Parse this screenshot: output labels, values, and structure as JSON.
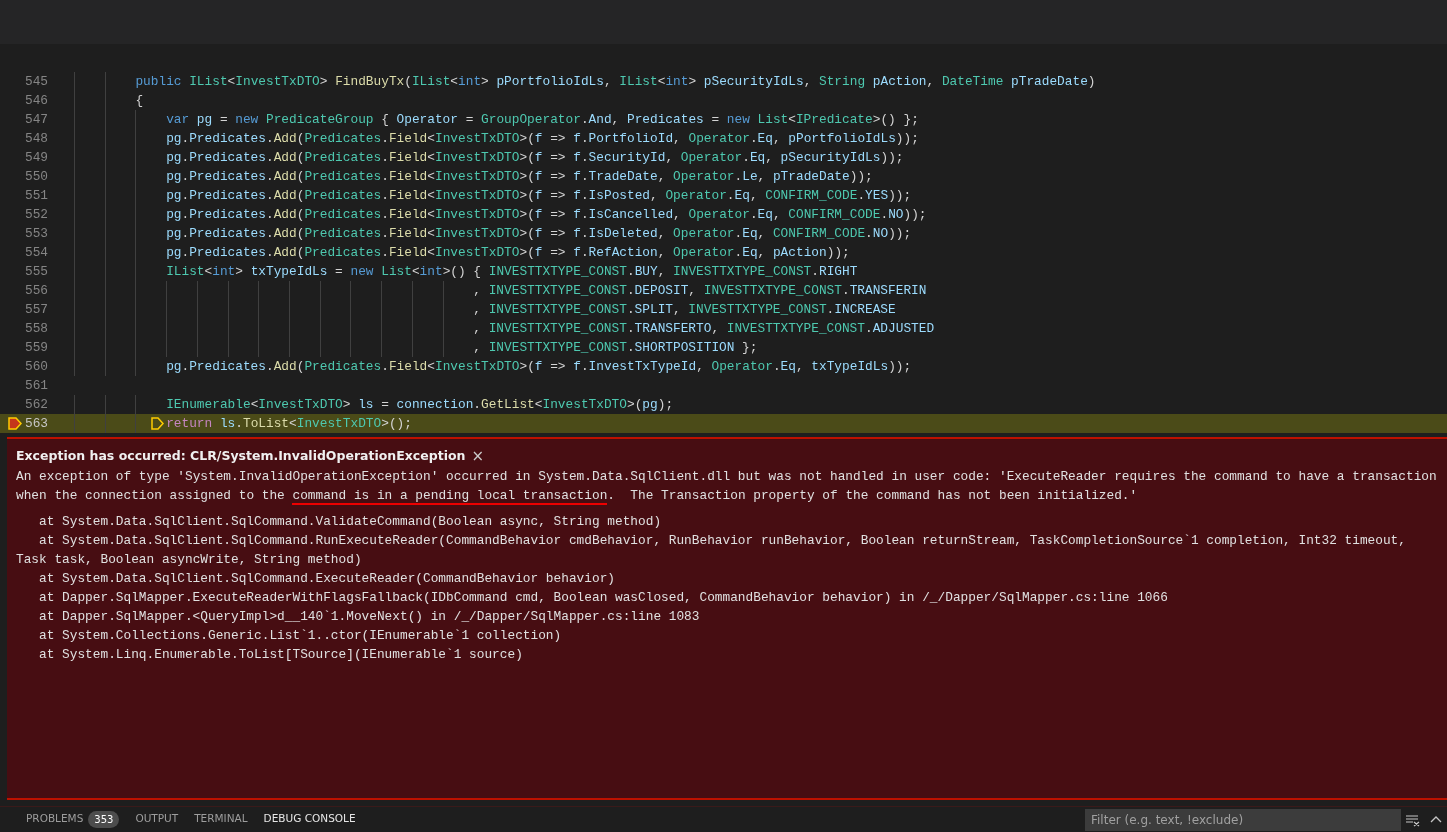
{
  "editor": {
    "lines": [
      {
        "number": "545",
        "current": false,
        "segments": [
          {
            "kind": "keyword",
            "text": "        public "
          },
          {
            "kind": "type",
            "text": "IList"
          },
          {
            "kind": "plain",
            "text": "<"
          },
          {
            "kind": "type",
            "text": "InvestTxDTO"
          },
          {
            "kind": "plain",
            "text": "> "
          },
          {
            "kind": "function",
            "text": "FindBuyTx"
          },
          {
            "kind": "plain",
            "text": "("
          },
          {
            "kind": "type",
            "text": "IList"
          },
          {
            "kind": "plain",
            "text": "<"
          },
          {
            "kind": "keyword",
            "text": "int"
          },
          {
            "kind": "plain",
            "text": "> "
          },
          {
            "kind": "variable",
            "text": "pPortfolioIdLs"
          },
          {
            "kind": "plain",
            "text": ", "
          },
          {
            "kind": "type",
            "text": "IList"
          },
          {
            "kind": "plain",
            "text": "<"
          },
          {
            "kind": "keyword",
            "text": "int"
          },
          {
            "kind": "plain",
            "text": "> "
          },
          {
            "kind": "variable",
            "text": "pSecurityIdLs"
          },
          {
            "kind": "plain",
            "text": ", "
          },
          {
            "kind": "type",
            "text": "String "
          },
          {
            "kind": "variable",
            "text": "pAction"
          },
          {
            "kind": "plain",
            "text": ", "
          },
          {
            "kind": "type",
            "text": "DateTime "
          },
          {
            "kind": "variable",
            "text": "pTradeDate"
          },
          {
            "kind": "plain",
            "text": ")"
          }
        ]
      },
      {
        "number": "546",
        "current": false,
        "segments": [
          {
            "kind": "plain",
            "text": "        {"
          }
        ]
      },
      {
        "number": "547",
        "current": false,
        "segments": [
          {
            "kind": "keyword",
            "text": "            var "
          },
          {
            "kind": "variable",
            "text": "pg"
          },
          {
            "kind": "plain",
            "text": " = "
          },
          {
            "kind": "keyword",
            "text": "new "
          },
          {
            "kind": "type",
            "text": "PredicateGroup"
          },
          {
            "kind": "plain",
            "text": " { "
          },
          {
            "kind": "variable",
            "text": "Operator"
          },
          {
            "kind": "plain",
            "text": " = "
          },
          {
            "kind": "type",
            "text": "GroupOperator"
          },
          {
            "kind": "plain",
            "text": "."
          },
          {
            "kind": "variable",
            "text": "And"
          },
          {
            "kind": "plain",
            "text": ", "
          },
          {
            "kind": "variable",
            "text": "Predicates"
          },
          {
            "kind": "plain",
            "text": " = "
          },
          {
            "kind": "keyword",
            "text": "new "
          },
          {
            "kind": "type",
            "text": "List"
          },
          {
            "kind": "plain",
            "text": "<"
          },
          {
            "kind": "type",
            "text": "IPredicate"
          },
          {
            "kind": "plain",
            "text": ">() };"
          }
        ]
      },
      {
        "number": "548",
        "current": false,
        "segments": [
          {
            "kind": "variable",
            "text": "            pg"
          },
          {
            "kind": "plain",
            "text": "."
          },
          {
            "kind": "variable",
            "text": "Predicates"
          },
          {
            "kind": "plain",
            "text": "."
          },
          {
            "kind": "function",
            "text": "Add"
          },
          {
            "kind": "plain",
            "text": "("
          },
          {
            "kind": "type",
            "text": "Predicates"
          },
          {
            "kind": "plain",
            "text": "."
          },
          {
            "kind": "function",
            "text": "Field"
          },
          {
            "kind": "plain",
            "text": "<"
          },
          {
            "kind": "type",
            "text": "InvestTxDTO"
          },
          {
            "kind": "plain",
            "text": ">("
          },
          {
            "kind": "variable",
            "text": "f"
          },
          {
            "kind": "plain",
            "text": " => "
          },
          {
            "kind": "variable",
            "text": "f"
          },
          {
            "kind": "plain",
            "text": "."
          },
          {
            "kind": "variable",
            "text": "PortfolioId"
          },
          {
            "kind": "plain",
            "text": ", "
          },
          {
            "kind": "type",
            "text": "Operator"
          },
          {
            "kind": "plain",
            "text": "."
          },
          {
            "kind": "variable",
            "text": "Eq"
          },
          {
            "kind": "plain",
            "text": ", "
          },
          {
            "kind": "variable",
            "text": "pPortfolioIdLs"
          },
          {
            "kind": "plain",
            "text": "));"
          }
        ]
      },
      {
        "number": "549",
        "current": false,
        "segments": [
          {
            "kind": "variable",
            "text": "            pg"
          },
          {
            "kind": "plain",
            "text": "."
          },
          {
            "kind": "variable",
            "text": "Predicates"
          },
          {
            "kind": "plain",
            "text": "."
          },
          {
            "kind": "function",
            "text": "Add"
          },
          {
            "kind": "plain",
            "text": "("
          },
          {
            "kind": "type",
            "text": "Predicates"
          },
          {
            "kind": "plain",
            "text": "."
          },
          {
            "kind": "function",
            "text": "Field"
          },
          {
            "kind": "plain",
            "text": "<"
          },
          {
            "kind": "type",
            "text": "InvestTxDTO"
          },
          {
            "kind": "plain",
            "text": ">("
          },
          {
            "kind": "variable",
            "text": "f"
          },
          {
            "kind": "plain",
            "text": " => "
          },
          {
            "kind": "variable",
            "text": "f"
          },
          {
            "kind": "plain",
            "text": "."
          },
          {
            "kind": "variable",
            "text": "SecurityId"
          },
          {
            "kind": "plain",
            "text": ", "
          },
          {
            "kind": "type",
            "text": "Operator"
          },
          {
            "kind": "plain",
            "text": "."
          },
          {
            "kind": "variable",
            "text": "Eq"
          },
          {
            "kind": "plain",
            "text": ", "
          },
          {
            "kind": "variable",
            "text": "pSecurityIdLs"
          },
          {
            "kind": "plain",
            "text": "));"
          }
        ]
      },
      {
        "number": "550",
        "current": false,
        "segments": [
          {
            "kind": "variable",
            "text": "            pg"
          },
          {
            "kind": "plain",
            "text": "."
          },
          {
            "kind": "variable",
            "text": "Predicates"
          },
          {
            "kind": "plain",
            "text": "."
          },
          {
            "kind": "function",
            "text": "Add"
          },
          {
            "kind": "plain",
            "text": "("
          },
          {
            "kind": "type",
            "text": "Predicates"
          },
          {
            "kind": "plain",
            "text": "."
          },
          {
            "kind": "function",
            "text": "Field"
          },
          {
            "kind": "plain",
            "text": "<"
          },
          {
            "kind": "type",
            "text": "InvestTxDTO"
          },
          {
            "kind": "plain",
            "text": ">("
          },
          {
            "kind": "variable",
            "text": "f"
          },
          {
            "kind": "plain",
            "text": " => "
          },
          {
            "kind": "variable",
            "text": "f"
          },
          {
            "kind": "plain",
            "text": "."
          },
          {
            "kind": "variable",
            "text": "TradeDate"
          },
          {
            "kind": "plain",
            "text": ", "
          },
          {
            "kind": "type",
            "text": "Operator"
          },
          {
            "kind": "plain",
            "text": "."
          },
          {
            "kind": "variable",
            "text": "Le"
          },
          {
            "kind": "plain",
            "text": ", "
          },
          {
            "kind": "variable",
            "text": "pTradeDate"
          },
          {
            "kind": "plain",
            "text": "));"
          }
        ]
      },
      {
        "number": "551",
        "current": false,
        "segments": [
          {
            "kind": "variable",
            "text": "            pg"
          },
          {
            "kind": "plain",
            "text": "."
          },
          {
            "kind": "variable",
            "text": "Predicates"
          },
          {
            "kind": "plain",
            "text": "."
          },
          {
            "kind": "function",
            "text": "Add"
          },
          {
            "kind": "plain",
            "text": "("
          },
          {
            "kind": "type",
            "text": "Predicates"
          },
          {
            "kind": "plain",
            "text": "."
          },
          {
            "kind": "function",
            "text": "Field"
          },
          {
            "kind": "plain",
            "text": "<"
          },
          {
            "kind": "type",
            "text": "InvestTxDTO"
          },
          {
            "kind": "plain",
            "text": ">("
          },
          {
            "kind": "variable",
            "text": "f"
          },
          {
            "kind": "plain",
            "text": " => "
          },
          {
            "kind": "variable",
            "text": "f"
          },
          {
            "kind": "plain",
            "text": "."
          },
          {
            "kind": "variable",
            "text": "IsPosted"
          },
          {
            "kind": "plain",
            "text": ", "
          },
          {
            "kind": "type",
            "text": "Operator"
          },
          {
            "kind": "plain",
            "text": "."
          },
          {
            "kind": "variable",
            "text": "Eq"
          },
          {
            "kind": "plain",
            "text": ", "
          },
          {
            "kind": "type",
            "text": "CONFIRM_CODE"
          },
          {
            "kind": "plain",
            "text": "."
          },
          {
            "kind": "variable",
            "text": "YES"
          },
          {
            "kind": "plain",
            "text": "));"
          }
        ]
      },
      {
        "number": "552",
        "current": false,
        "segments": [
          {
            "kind": "variable",
            "text": "            pg"
          },
          {
            "kind": "plain",
            "text": "."
          },
          {
            "kind": "variable",
            "text": "Predicates"
          },
          {
            "kind": "plain",
            "text": "."
          },
          {
            "kind": "function",
            "text": "Add"
          },
          {
            "kind": "plain",
            "text": "("
          },
          {
            "kind": "type",
            "text": "Predicates"
          },
          {
            "kind": "plain",
            "text": "."
          },
          {
            "kind": "function",
            "text": "Field"
          },
          {
            "kind": "plain",
            "text": "<"
          },
          {
            "kind": "type",
            "text": "InvestTxDTO"
          },
          {
            "kind": "plain",
            "text": ">("
          },
          {
            "kind": "variable",
            "text": "f"
          },
          {
            "kind": "plain",
            "text": " => "
          },
          {
            "kind": "variable",
            "text": "f"
          },
          {
            "kind": "plain",
            "text": "."
          },
          {
            "kind": "variable",
            "text": "IsCancelled"
          },
          {
            "kind": "plain",
            "text": ", "
          },
          {
            "kind": "type",
            "text": "Operator"
          },
          {
            "kind": "plain",
            "text": "."
          },
          {
            "kind": "variable",
            "text": "Eq"
          },
          {
            "kind": "plain",
            "text": ", "
          },
          {
            "kind": "type",
            "text": "CONFIRM_CODE"
          },
          {
            "kind": "plain",
            "text": "."
          },
          {
            "kind": "variable",
            "text": "NO"
          },
          {
            "kind": "plain",
            "text": "));"
          }
        ]
      },
      {
        "number": "553",
        "current": false,
        "segments": [
          {
            "kind": "variable",
            "text": "            pg"
          },
          {
            "kind": "plain",
            "text": "."
          },
          {
            "kind": "variable",
            "text": "Predicates"
          },
          {
            "kind": "plain",
            "text": "."
          },
          {
            "kind": "function",
            "text": "Add"
          },
          {
            "kind": "plain",
            "text": "("
          },
          {
            "kind": "type",
            "text": "Predicates"
          },
          {
            "kind": "plain",
            "text": "."
          },
          {
            "kind": "function",
            "text": "Field"
          },
          {
            "kind": "plain",
            "text": "<"
          },
          {
            "kind": "type",
            "text": "InvestTxDTO"
          },
          {
            "kind": "plain",
            "text": ">("
          },
          {
            "kind": "variable",
            "text": "f"
          },
          {
            "kind": "plain",
            "text": " => "
          },
          {
            "kind": "variable",
            "text": "f"
          },
          {
            "kind": "plain",
            "text": "."
          },
          {
            "kind": "variable",
            "text": "IsDeleted"
          },
          {
            "kind": "plain",
            "text": ", "
          },
          {
            "kind": "type",
            "text": "Operator"
          },
          {
            "kind": "plain",
            "text": "."
          },
          {
            "kind": "variable",
            "text": "Eq"
          },
          {
            "kind": "plain",
            "text": ", "
          },
          {
            "kind": "type",
            "text": "CONFIRM_CODE"
          },
          {
            "kind": "plain",
            "text": "."
          },
          {
            "kind": "variable",
            "text": "NO"
          },
          {
            "kind": "plain",
            "text": "));"
          }
        ]
      },
      {
        "number": "554",
        "current": false,
        "segments": [
          {
            "kind": "variable",
            "text": "            pg"
          },
          {
            "kind": "plain",
            "text": "."
          },
          {
            "kind": "variable",
            "text": "Predicates"
          },
          {
            "kind": "plain",
            "text": "."
          },
          {
            "kind": "function",
            "text": "Add"
          },
          {
            "kind": "plain",
            "text": "("
          },
          {
            "kind": "type",
            "text": "Predicates"
          },
          {
            "kind": "plain",
            "text": "."
          },
          {
            "kind": "function",
            "text": "Field"
          },
          {
            "kind": "plain",
            "text": "<"
          },
          {
            "kind": "type",
            "text": "InvestTxDTO"
          },
          {
            "kind": "plain",
            "text": ">("
          },
          {
            "kind": "variable",
            "text": "f"
          },
          {
            "kind": "plain",
            "text": " => "
          },
          {
            "kind": "variable",
            "text": "f"
          },
          {
            "kind": "plain",
            "text": "."
          },
          {
            "kind": "variable",
            "text": "RefAction"
          },
          {
            "kind": "plain",
            "text": ", "
          },
          {
            "kind": "type",
            "text": "Operator"
          },
          {
            "kind": "plain",
            "text": "."
          },
          {
            "kind": "variable",
            "text": "Eq"
          },
          {
            "kind": "plain",
            "text": ", "
          },
          {
            "kind": "variable",
            "text": "pAction"
          },
          {
            "kind": "plain",
            "text": "));"
          }
        ]
      },
      {
        "number": "555",
        "current": false,
        "segments": [
          {
            "kind": "type",
            "text": "            IList"
          },
          {
            "kind": "plain",
            "text": "<"
          },
          {
            "kind": "keyword",
            "text": "int"
          },
          {
            "kind": "plain",
            "text": "> "
          },
          {
            "kind": "variable",
            "text": "txTypeIdLs"
          },
          {
            "kind": "plain",
            "text": " = "
          },
          {
            "kind": "keyword",
            "text": "new "
          },
          {
            "kind": "type",
            "text": "List"
          },
          {
            "kind": "plain",
            "text": "<"
          },
          {
            "kind": "keyword",
            "text": "int"
          },
          {
            "kind": "plain",
            "text": ">() { "
          },
          {
            "kind": "type",
            "text": "INVESTTXTYPE_CONST"
          },
          {
            "kind": "plain",
            "text": "."
          },
          {
            "kind": "variable",
            "text": "BUY"
          },
          {
            "kind": "plain",
            "text": ", "
          },
          {
            "kind": "type",
            "text": "INVESTTXTYPE_CONST"
          },
          {
            "kind": "plain",
            "text": "."
          },
          {
            "kind": "variable",
            "text": "RIGHT"
          }
        ]
      },
      {
        "number": "556",
        "current": false,
        "segments": [
          {
            "kind": "plain",
            "text": "                                                    , "
          },
          {
            "kind": "type",
            "text": "INVESTTXTYPE_CONST"
          },
          {
            "kind": "plain",
            "text": "."
          },
          {
            "kind": "variable",
            "text": "DEPOSIT"
          },
          {
            "kind": "plain",
            "text": ", "
          },
          {
            "kind": "type",
            "text": "INVESTTXTYPE_CONST"
          },
          {
            "kind": "plain",
            "text": "."
          },
          {
            "kind": "variable",
            "text": "TRANSFERIN"
          }
        ]
      },
      {
        "number": "557",
        "current": false,
        "segments": [
          {
            "kind": "plain",
            "text": "                                                    , "
          },
          {
            "kind": "type",
            "text": "INVESTTXTYPE_CONST"
          },
          {
            "kind": "plain",
            "text": "."
          },
          {
            "kind": "variable",
            "text": "SPLIT"
          },
          {
            "kind": "plain",
            "text": ", "
          },
          {
            "kind": "type",
            "text": "INVESTTXTYPE_CONST"
          },
          {
            "kind": "plain",
            "text": "."
          },
          {
            "kind": "variable",
            "text": "INCREASE"
          }
        ]
      },
      {
        "number": "558",
        "current": false,
        "segments": [
          {
            "kind": "plain",
            "text": "                                                    , "
          },
          {
            "kind": "type",
            "text": "INVESTTXTYPE_CONST"
          },
          {
            "kind": "plain",
            "text": "."
          },
          {
            "kind": "variable",
            "text": "TRANSFERTO"
          },
          {
            "kind": "plain",
            "text": ", "
          },
          {
            "kind": "type",
            "text": "INVESTTXTYPE_CONST"
          },
          {
            "kind": "plain",
            "text": "."
          },
          {
            "kind": "variable",
            "text": "ADJUSTED"
          }
        ]
      },
      {
        "number": "559",
        "current": false,
        "segments": [
          {
            "kind": "plain",
            "text": "                                                    , "
          },
          {
            "kind": "type",
            "text": "INVESTTXTYPE_CONST"
          },
          {
            "kind": "plain",
            "text": "."
          },
          {
            "kind": "variable",
            "text": "SHORTPOSITION"
          },
          {
            "kind": "plain",
            "text": " };"
          }
        ]
      },
      {
        "number": "560",
        "current": false,
        "segments": [
          {
            "kind": "variable",
            "text": "            pg"
          },
          {
            "kind": "plain",
            "text": "."
          },
          {
            "kind": "variable",
            "text": "Predicates"
          },
          {
            "kind": "plain",
            "text": "."
          },
          {
            "kind": "function",
            "text": "Add"
          },
          {
            "kind": "plain",
            "text": "("
          },
          {
            "kind": "type",
            "text": "Predicates"
          },
          {
            "kind": "plain",
            "text": "."
          },
          {
            "kind": "function",
            "text": "Field"
          },
          {
            "kind": "plain",
            "text": "<"
          },
          {
            "kind": "type",
            "text": "InvestTxDTO"
          },
          {
            "kind": "plain",
            "text": ">("
          },
          {
            "kind": "variable",
            "text": "f"
          },
          {
            "kind": "plain",
            "text": " => "
          },
          {
            "kind": "variable",
            "text": "f"
          },
          {
            "kind": "plain",
            "text": "."
          },
          {
            "kind": "variable",
            "text": "InvestTxTypeId"
          },
          {
            "kind": "plain",
            "text": ", "
          },
          {
            "kind": "type",
            "text": "Operator"
          },
          {
            "kind": "plain",
            "text": "."
          },
          {
            "kind": "variable",
            "text": "Eq"
          },
          {
            "kind": "plain",
            "text": ", "
          },
          {
            "kind": "variable",
            "text": "txTypeIdLs"
          },
          {
            "kind": "plain",
            "text": "));"
          }
        ]
      },
      {
        "number": "561",
        "current": false
      },
      {
        "number": "562",
        "current": false,
        "segments": [
          {
            "kind": "type",
            "text": "            IEnumerable"
          },
          {
            "kind": "plain",
            "text": "<"
          },
          {
            "kind": "type",
            "text": "InvestTxDTO"
          },
          {
            "kind": "plain",
            "text": "> "
          },
          {
            "kind": "variable",
            "text": "ls"
          },
          {
            "kind": "plain",
            "text": " = "
          },
          {
            "kind": "variable",
            "text": "connection"
          },
          {
            "kind": "plain",
            "text": "."
          },
          {
            "kind": "function",
            "text": "GetList"
          },
          {
            "kind": "plain",
            "text": "<"
          },
          {
            "kind": "type",
            "text": "InvestTxDTO"
          },
          {
            "kind": "plain",
            "text": ">("
          },
          {
            "kind": "variable",
            "text": "pg"
          },
          {
            "kind": "plain",
            "text": ");"
          }
        ]
      },
      {
        "number": "563",
        "current": true,
        "segments": [
          {
            "kind": "control",
            "text": "            return "
          },
          {
            "kind": "variable",
            "text": "ls"
          },
          {
            "kind": "plain",
            "text": "."
          },
          {
            "kind": "function",
            "text": "ToList"
          },
          {
            "kind": "plain",
            "text": "<"
          },
          {
            "kind": "type",
            "text": "InvestTxDTO"
          },
          {
            "kind": "plain",
            "text": ">();"
          }
        ]
      }
    ]
  },
  "exception": {
    "title": "Exception has occurred: CLR/System.InvalidOperationException",
    "close": "×",
    "message": [
      {
        "text": "An exception of type 'System.InvalidOperationException' occurred in System.Data.SqlClient.dll but was not handled in user code: 'ExecuteReader requires the command to have a transaction when the connection assigned to the ",
        "underlined": false
      },
      {
        "text": "command is in a pending local transaction",
        "underlined": true
      },
      {
        "text": ".  The Transaction property of the command has not been initialized.'",
        "underlined": false
      }
    ],
    "stack": [
      "at System.Data.SqlClient.SqlCommand.ValidateCommand(Boolean async, String method)",
      "at System.Data.SqlClient.SqlCommand.RunExecuteReader(CommandBehavior cmdBehavior, RunBehavior runBehavior, Boolean returnStream, TaskCompletionSource`1 completion, Int32 timeout, Task task, Boolean asyncWrite, String method)",
      "at System.Data.SqlClient.SqlCommand.ExecuteReader(CommandBehavior behavior)",
      "at Dapper.SqlMapper.ExecuteReaderWithFlagsFallback(IDbCommand cmd, Boolean wasClosed, CommandBehavior behavior) in /_/Dapper/SqlMapper.cs:line 1066",
      "at Dapper.SqlMapper.<QueryImpl>d__140`1.MoveNext() in /_/Dapper/SqlMapper.cs:line 1083",
      "at System.Collections.Generic.List`1..ctor(IEnumerable`1 collection)",
      "at System.Linq.Enumerable.ToList[TSource](IEnumerable`1 source)"
    ]
  },
  "panel": {
    "tabs": [
      {
        "label": "PROBLEMS",
        "badge": "353",
        "selected": false
      },
      {
        "label": "OUTPUT",
        "selected": false
      },
      {
        "label": "TERMINAL",
        "selected": false
      },
      {
        "label": "DEBUG CONSOLE",
        "selected": true
      }
    ],
    "filter": {
      "placeholder": "Filter (e.g. text, !exclude)"
    }
  }
}
